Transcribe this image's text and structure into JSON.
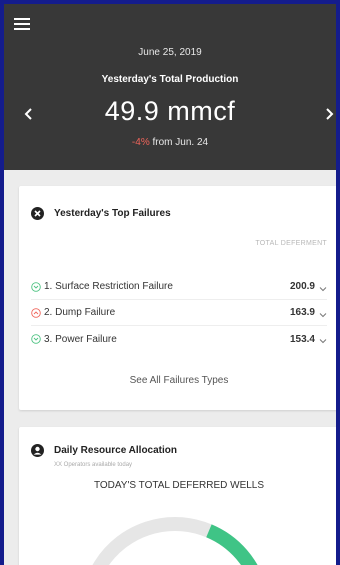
{
  "header": {
    "date": "June 25, 2019",
    "title": "Yesterday's Total Production",
    "value": "49.9 mmcf",
    "change_pct": "-4%",
    "change_text": " from Jun. 24"
  },
  "failures": {
    "title": "Yesterday's Top Failures",
    "column_header": "TOTAL DEFERMENT",
    "items": [
      {
        "label": "1. Surface Restriction Failure",
        "value": "200.9",
        "trend": "down"
      },
      {
        "label": "2. Dump Failure",
        "value": "163.9",
        "trend": "up"
      },
      {
        "label": "3. Power Failure",
        "value": "153.4",
        "trend": "down"
      }
    ],
    "see_all": "See All Failures Types"
  },
  "allocation": {
    "title": "Daily Resource Allocation",
    "subtitle": "XX Operators available today",
    "deferred_title": "TODAY'S TOTAL DEFERRED WELLS",
    "gauge_fraction": 0.35
  },
  "colors": {
    "background": "#141c8c",
    "header": "#383838",
    "negative": "#f0645a",
    "positive": "#4cc281",
    "gauge_fill": "#3fc486",
    "gauge_track": "#e6e6e6"
  },
  "icons": [
    "menu-icon",
    "chevron-left-icon",
    "chevron-right-icon",
    "close-circle-icon",
    "trend-down-icon",
    "trend-up-icon",
    "chevron-down-icon",
    "account-circle-icon"
  ]
}
